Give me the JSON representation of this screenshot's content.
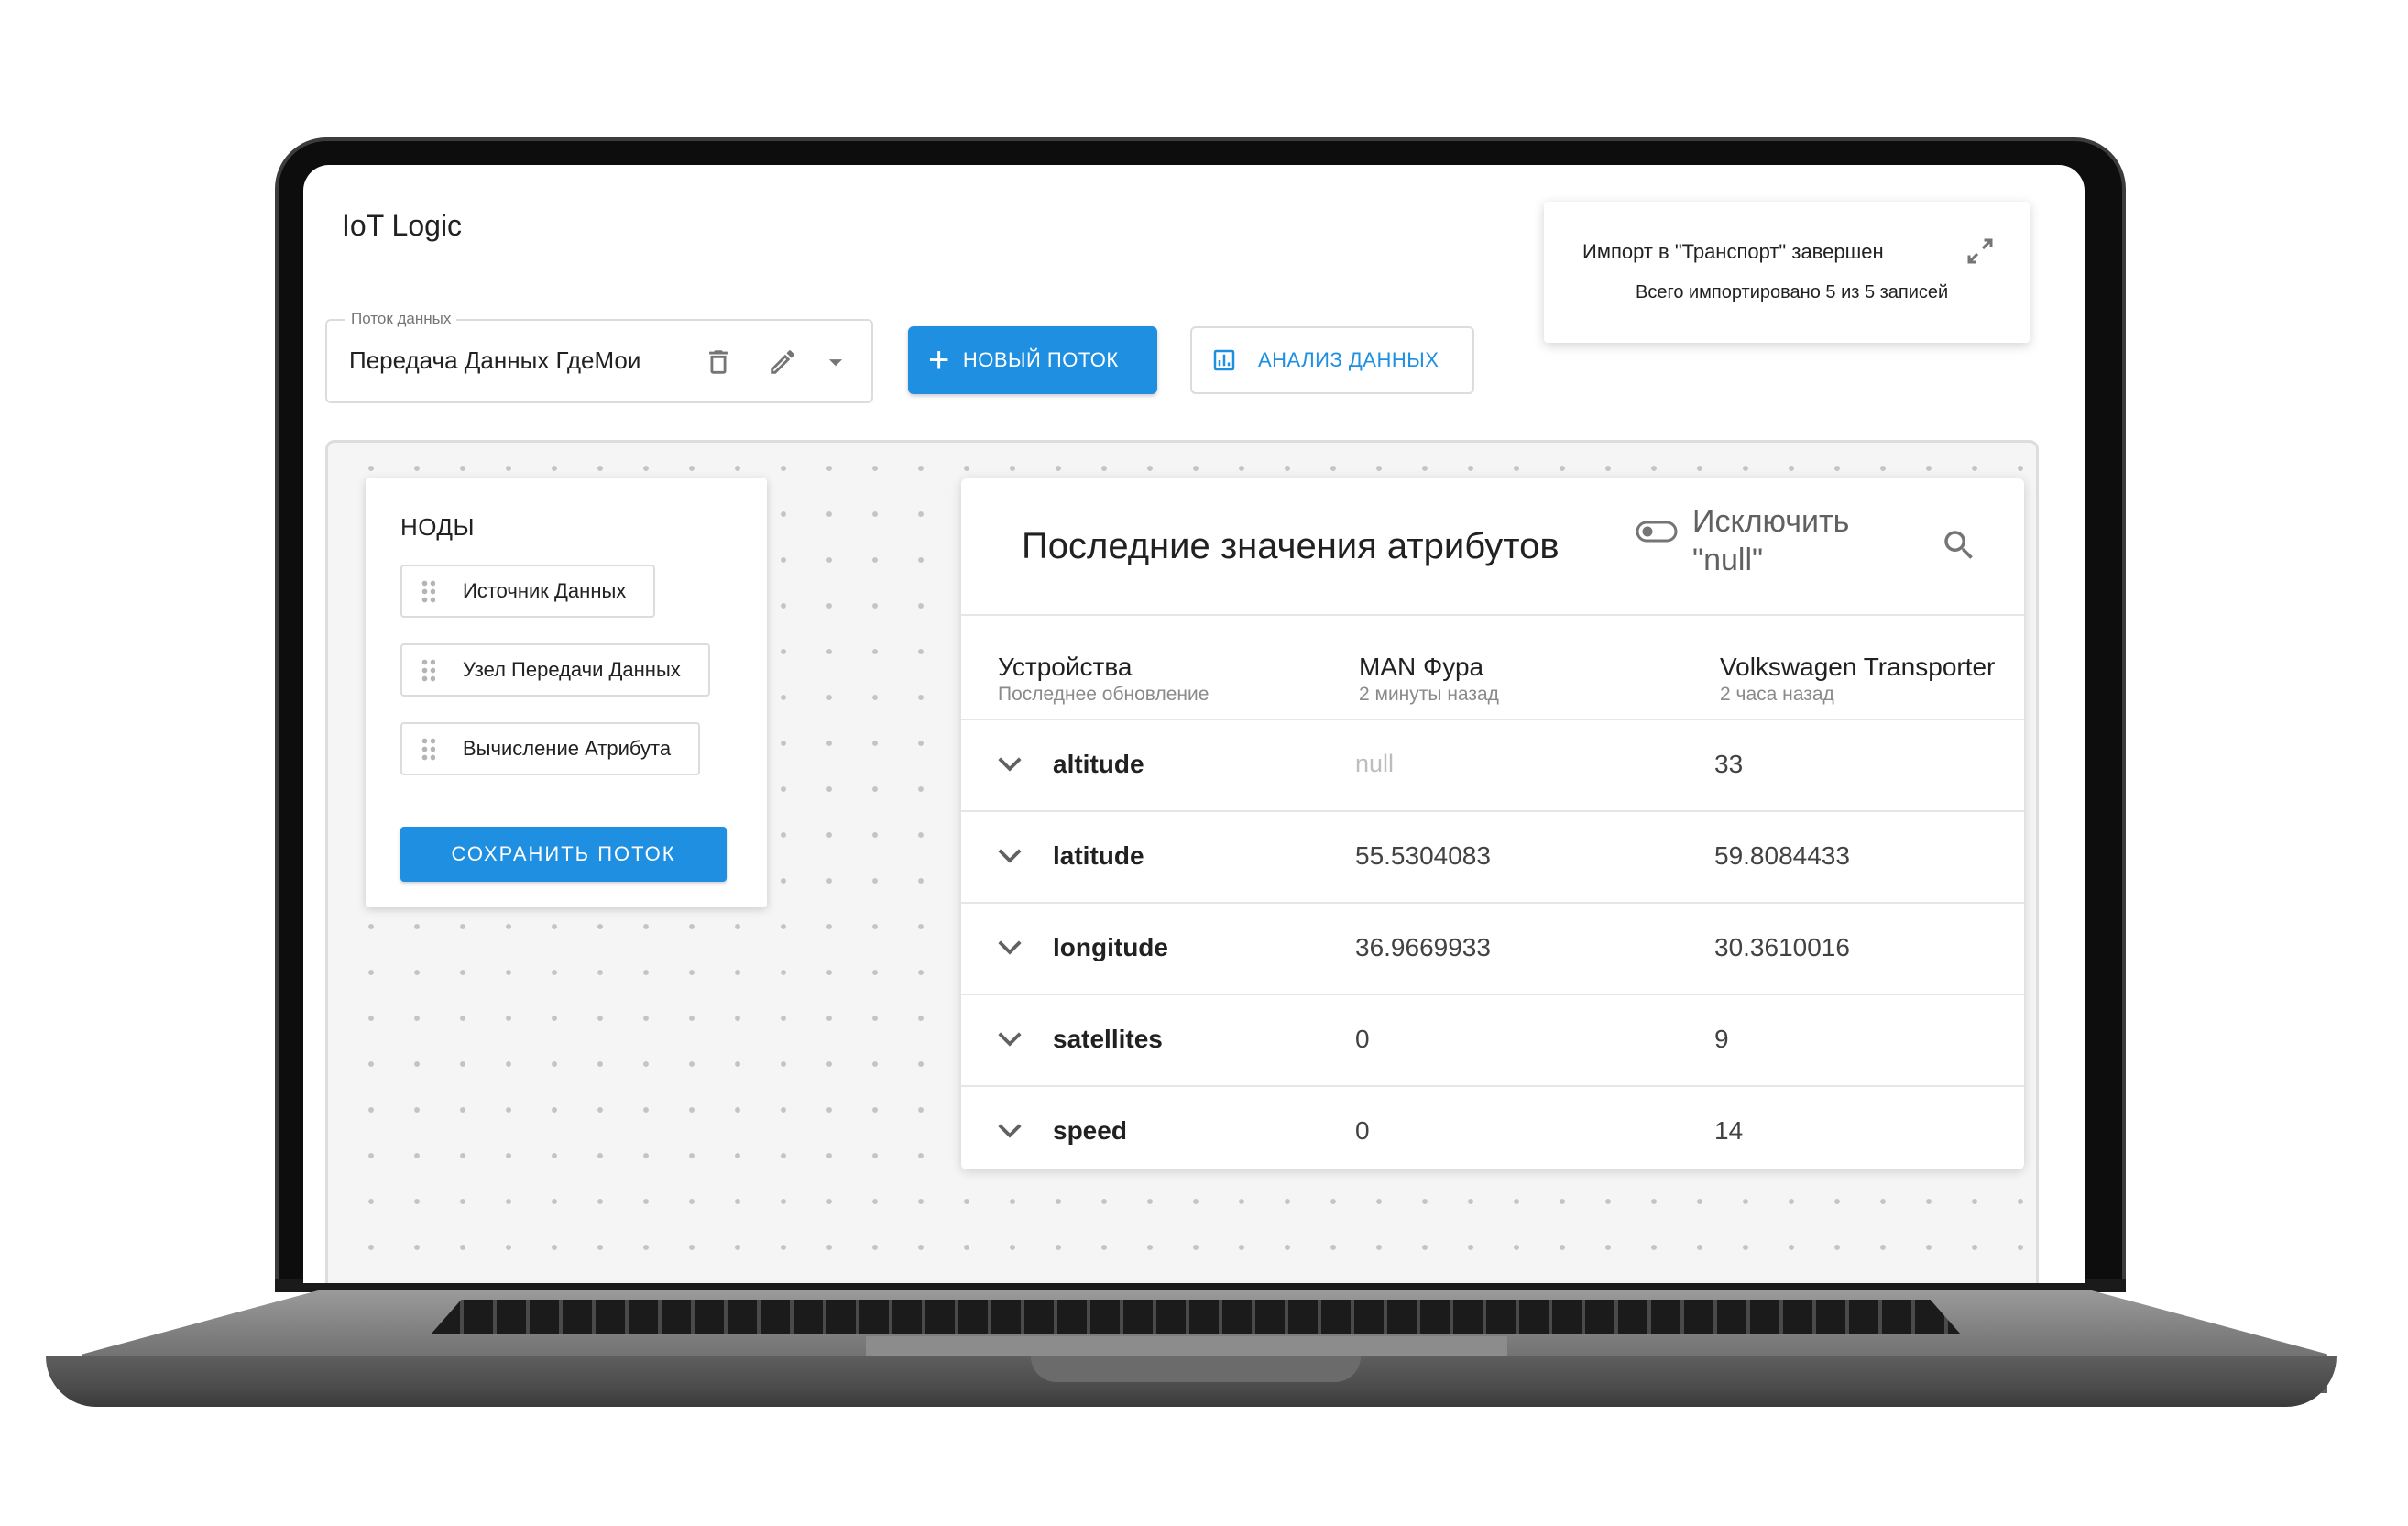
{
  "app": {
    "title": "IoT Logic"
  },
  "flow": {
    "label": "Поток данных",
    "value": "Передача Данных ГдеМои",
    "icons": [
      "trash-icon",
      "pencil-icon",
      "dropdown-arrow-icon"
    ]
  },
  "toolbar": {
    "new_flow": "НОВЫЙ ПОТОК",
    "analyze": "АНАЛИЗ ДАННЫХ"
  },
  "toast": {
    "title": "Импорт в \"Транспорт\" завершен",
    "subtitle": "Всего импортировано 5 из 5 записей"
  },
  "nodes": {
    "title": "НОДЫ",
    "items": [
      "Источник Данных",
      "Узел Передачи Данных",
      "Вычисление Атрибута"
    ],
    "save": "СОХРАНИТЬ ПОТОК"
  },
  "attributes": {
    "title": "Последние значения атрибутов",
    "exclude_line1": "Исключить",
    "exclude_line2": "\"null\"",
    "columns": [
      {
        "name": "Устройства",
        "sub": "Последнее обновление"
      },
      {
        "name": "MAN Фура",
        "sub": "2 минуты назад"
      },
      {
        "name": "Volkswagen Transporter",
        "sub": "2 часа назад"
      }
    ],
    "rows": [
      {
        "name": "altitude",
        "v1": "null",
        "v2": "33"
      },
      {
        "name": "latitude",
        "v1": "55.5304083",
        "v2": "59.8084433"
      },
      {
        "name": "longitude",
        "v1": "36.9669933",
        "v2": "30.3610016"
      },
      {
        "name": "satellites",
        "v1": "0",
        "v2": "9"
      },
      {
        "name": "speed",
        "v1": "0",
        "v2": "14"
      }
    ]
  },
  "colors": {
    "accent": "#1e8fe1",
    "canvas": "#f5f5f5",
    "dot": "#c4c4c4",
    "bezel": "#0d0d0d"
  }
}
